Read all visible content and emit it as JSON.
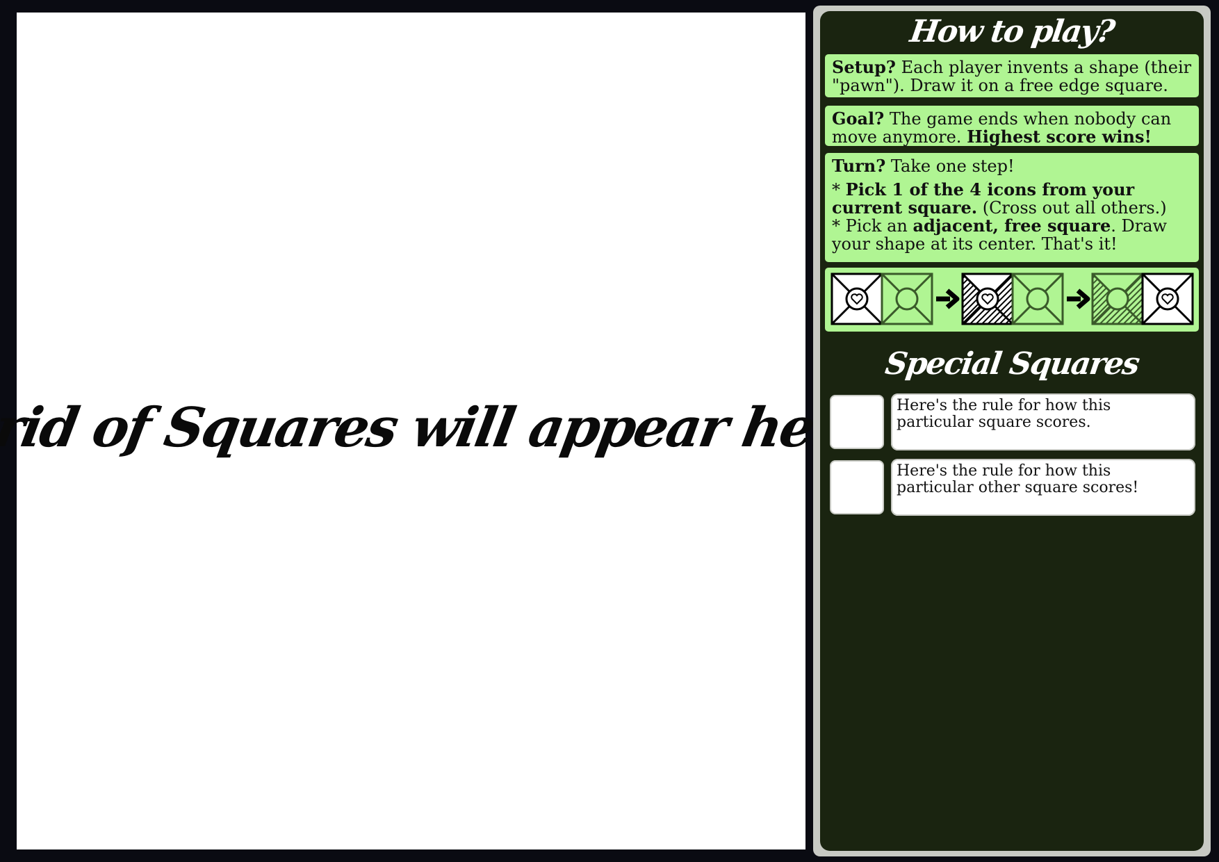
{
  "board": {
    "placeholder": "Grid of Squares will appear here"
  },
  "rules": {
    "title": "How to play?",
    "setup": {
      "label": "Setup?",
      "text": " Each player invents a shape (their \"pawn\"). Draw it on a free edge square."
    },
    "goal": {
      "label": "Goal?",
      "text": " The game ends when nobody can move anymore. ",
      "emphasis": "Highest score wins!"
    },
    "turn": {
      "label": "Turn?",
      "text": " Take one step!",
      "step1_prefix": "* ",
      "step1_bold": "Pick 1 of the 4 icons from your current square.",
      "step1_rest": " (Cross out all others.)",
      "step2_prefix": "* Pick an ",
      "step2_bold": "adjacent, free square",
      "step2_rest": ". Draw your shape at its center. That's it!"
    },
    "example_icons": [
      "heart-icon",
      "circle-icon"
    ]
  },
  "special": {
    "title": "Special Squares",
    "items": [
      {
        "text": "Here's the rule for how this particular square scores."
      },
      {
        "text": "Here's the rule for how this particular other square scores!"
      }
    ]
  },
  "colors": {
    "panel_bg": "#1a2410",
    "box_bg": "#b0f593",
    "frame": "#c8cac4",
    "faded_stroke": "#3a5a2a"
  }
}
